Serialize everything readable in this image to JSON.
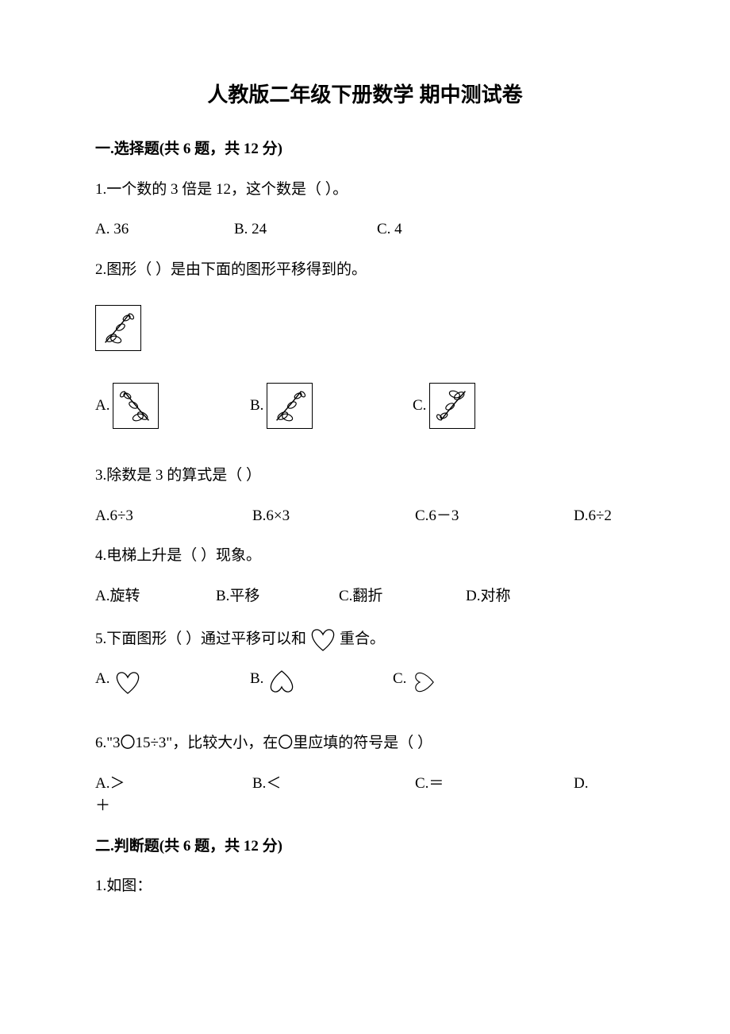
{
  "title": "人教版二年级下册数学 期中测试卷",
  "section1": {
    "header": "一.选择题(共 6 题，共 12 分)",
    "q1": {
      "text": "1.一个数的 3 倍是 12，这个数是（    ）。",
      "a": "A. 36",
      "b": "B. 24",
      "c": "C. 4"
    },
    "q2": {
      "text": "2.图形（     ）是由下面的图形平移得到的。",
      "a": "A.",
      "b": "B.",
      "c": "C."
    },
    "q3": {
      "text": "3.除数是 3 的算式是（    ）",
      "a": "A.6÷3",
      "b": "B.6×3",
      "c": "C.6－3",
      "d": "D.6÷2"
    },
    "q4": {
      "text": "4.电梯上升是（     ）现象。",
      "a": "A.旋转",
      "b": "B.平移",
      "c": "C.翻折",
      "d": "D.对称"
    },
    "q5": {
      "text_before": "5.下面图形（     ）通过平移可以和",
      "text_after": "重合。",
      "a": "A.",
      "b": "B.",
      "c": "C."
    },
    "q6": {
      "text": "6.\"3〇15÷3\"，比较大小，在〇里应填的符号是（    ）",
      "a": "A.＞",
      "b": "B.＜",
      "c": "C.＝",
      "d": "D.",
      "d_extra": "＋"
    }
  },
  "section2": {
    "header": "二.判断题(共 6 题，共 12 分)",
    "q1": {
      "text": "1.如图："
    }
  }
}
